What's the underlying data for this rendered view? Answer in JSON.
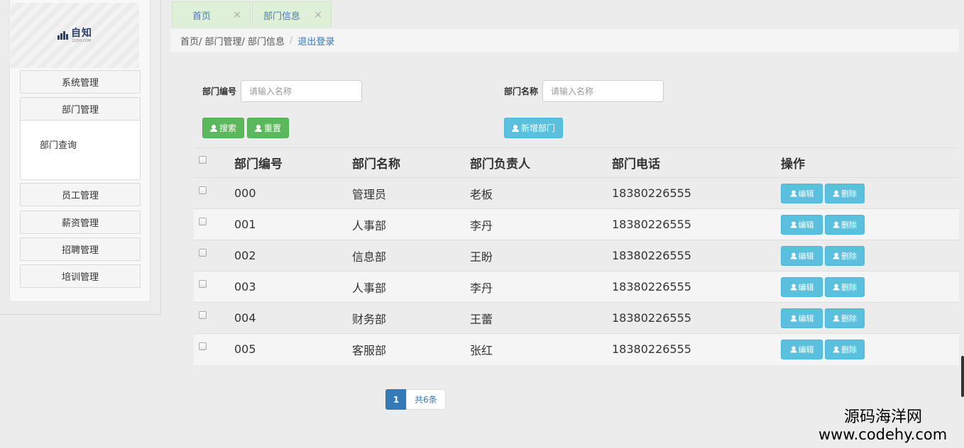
{
  "sidebar": {
    "logo_text": "自知",
    "logo_subtext": "ZIZHI.COM",
    "menu": [
      {
        "label": "系统管理"
      },
      {
        "label": "部门管理"
      },
      {
        "label": "员工管理"
      },
      {
        "label": "薪资管理"
      },
      {
        "label": "招聘管理"
      },
      {
        "label": "培训管理"
      }
    ],
    "submenu": [
      {
        "label": "部门查询"
      }
    ]
  },
  "tabs": [
    {
      "label": "首页",
      "close": "×"
    },
    {
      "label": "部门信息",
      "close": "×"
    }
  ],
  "breadcrumb": {
    "path": "首页/ 部门管理/ 部门信息",
    "separator": "/",
    "logout": "退出登录"
  },
  "search": {
    "dept_id_label": "部门编号",
    "dept_id_placeholder": "请输入名称",
    "dept_name_label": "部门名称",
    "dept_name_placeholder": "请输入名称",
    "search_button": "搜索",
    "reset_button": "重置",
    "add_button": "新增部门"
  },
  "table": {
    "headers": [
      "部门编号",
      "部门名称",
      "部门负责人",
      "部门电话",
      "操作"
    ],
    "rows": [
      {
        "id": "000",
        "name": "管理员",
        "lead": "老板",
        "phone": "18380226555"
      },
      {
        "id": "001",
        "name": "人事部",
        "lead": "李丹",
        "phone": "18380226555"
      },
      {
        "id": "002",
        "name": "信息部",
        "lead": "王盼",
        "phone": "18380226555"
      },
      {
        "id": "003",
        "name": "人事部",
        "lead": "李丹",
        "phone": "18380226555"
      },
      {
        "id": "004",
        "name": "财务部",
        "lead": "王蕾",
        "phone": "18380226555"
      },
      {
        "id": "005",
        "name": "客服部",
        "lead": "张红",
        "phone": "18380226555"
      }
    ],
    "edit_label": "编辑",
    "delete_label": "删除"
  },
  "pagination": {
    "current": "1",
    "total": "共6条"
  },
  "watermark": {
    "text": "源码海洋网",
    "url": "www.codehy.com"
  },
  "colors": {
    "success": "#5cb85c",
    "info": "#5bc0de",
    "primary": "#337ab7",
    "tab_bg": "#dff0d8"
  }
}
